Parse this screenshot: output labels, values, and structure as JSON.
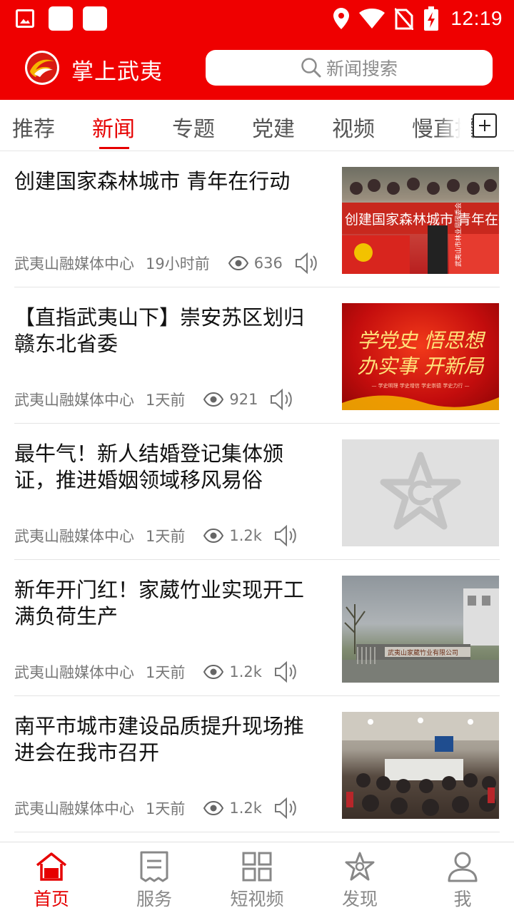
{
  "status_bar": {
    "time": "12:19",
    "left_icons": [
      "gallery-icon",
      "app-square-icon",
      "app-square-icon"
    ],
    "right_icons": [
      "location-icon",
      "wifi-icon",
      "no-sim-icon",
      "battery-charging-icon"
    ]
  },
  "app_bar": {
    "title": "掌上武夷",
    "search_placeholder": "新闻搜索",
    "colors": {
      "brand_red": "#ef0000",
      "accent_red": "#e60000"
    }
  },
  "tabs": {
    "items": [
      {
        "label": "推荐",
        "active": false
      },
      {
        "label": "新闻",
        "active": true
      },
      {
        "label": "专题",
        "active": false
      },
      {
        "label": "党建",
        "active": false
      },
      {
        "label": "视频",
        "active": false
      },
      {
        "label": "慢直播",
        "active": false
      }
    ],
    "add_icon": "plus-square-icon"
  },
  "news": [
    {
      "title": "创建国家森林城市 青年在行动",
      "source": "武夷山融媒体中心",
      "time": "19小时前",
      "views": "636",
      "thumb_text": "创建国家森林城市 青年在行动",
      "thumb_side_text": "武夷山市林业局团委会"
    },
    {
      "title": "【直指武夷山下】崇安苏区划归赣东北省委",
      "source": "武夷山融媒体中心",
      "time": "1天前",
      "views": "921",
      "thumb_line1": "学党史 悟思想",
      "thumb_line2": "办实事 开新局",
      "thumb_caption": "— 学史明理 学史增信 学史崇德 学史力行 —"
    },
    {
      "title": "最牛气！新人结婚登记集体颁证，推进婚姻领域移风易俗",
      "source": "武夷山融媒体中心",
      "time": "1天前",
      "views": "1.2k"
    },
    {
      "title": "新年开门红！家葳竹业实现开工满负荷生产",
      "source": "武夷山融媒体中心",
      "time": "1天前",
      "views": "1.2k",
      "thumb_text": "武夷山家葳竹业有限公司"
    },
    {
      "title": "南平市城市建设品质提升现场推进会在我市召开",
      "source": "武夷山融媒体中心",
      "time": "1天前",
      "views": "1.2k"
    }
  ],
  "bottom_nav": [
    {
      "label": "首页",
      "icon": "home-icon",
      "active": true
    },
    {
      "label": "服务",
      "icon": "service-icon",
      "active": false
    },
    {
      "label": "短视频",
      "icon": "grid-icon",
      "active": false
    },
    {
      "label": "发现",
      "icon": "discover-star-icon",
      "active": false
    },
    {
      "label": "我",
      "icon": "person-icon",
      "active": false
    }
  ]
}
